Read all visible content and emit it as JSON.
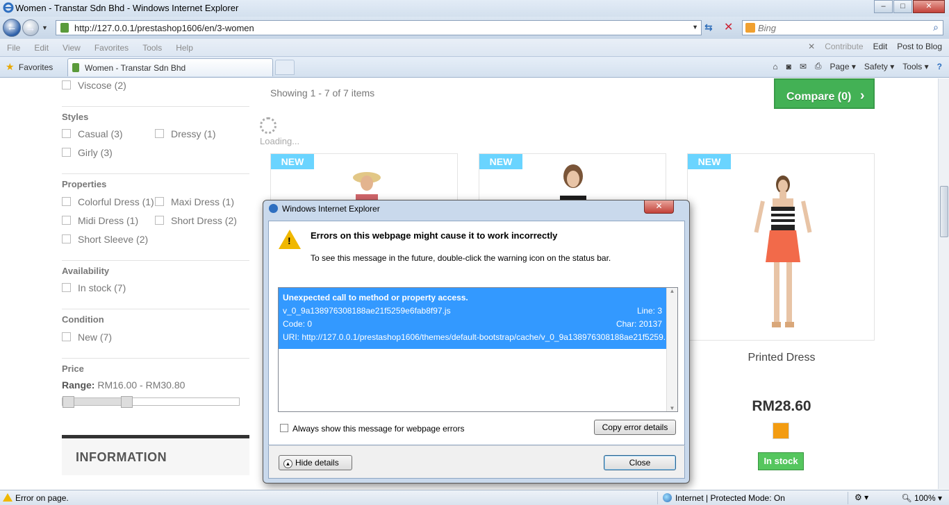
{
  "window": {
    "title": "Women - Transtar Sdn Bhd - Windows Internet Explorer",
    "controls": {
      "minimize": "–",
      "maximize": "□",
      "close": "✕"
    }
  },
  "address": {
    "back_glyph": "←",
    "forward_glyph": "→",
    "url": "http://127.0.0.1/prestashop1606/en/3-women",
    "search_placeholder": "Bing"
  },
  "menu": {
    "items": [
      "File",
      "Edit",
      "View",
      "Favorites",
      "Tools",
      "Help"
    ],
    "contribute": "Contribute",
    "edit": "Edit",
    "post_to_blog": "Post to Blog"
  },
  "favorites_bar": {
    "favorites_label": "Favorites",
    "tab_label": "Women - Transtar Sdn Bhd",
    "commands": [
      "Page ▾",
      "Safety ▾",
      "Tools ▾"
    ]
  },
  "sidebar": {
    "filters": {
      "viscose": "Viscose (2)",
      "styles_title": "Styles",
      "casual": "Casual (3)",
      "dressy": "Dressy (1)",
      "girly": "Girly (3)",
      "properties_title": "Properties",
      "colorful_dress": "Colorful Dress (1)",
      "maxi_dress": "Maxi Dress (1)",
      "midi_dress": "Midi Dress (1)",
      "short_dress": "Short Dress (2)",
      "short_sleeve": "Short Sleeve (2)",
      "availability_title": "Availability",
      "in_stock": "In stock (7)",
      "condition_title": "Condition",
      "new": "New (7)",
      "price_title": "Price",
      "range_label": "Range:",
      "range_value": " RM16.00 - RM30.80"
    },
    "price_slider": {
      "min_fraction": 0.0,
      "max_fraction": 0.35
    },
    "information_title": "INFORMATION"
  },
  "listing": {
    "showing": "Showing 1 - 7 of 7 items",
    "compare_label": "Compare (0)",
    "compare_arrow": "›",
    "loading": "Loading...",
    "new_badge": "NEW",
    "product_name": "Printed Dress",
    "product_price": "RM28.60",
    "availability": "In stock"
  },
  "dialog": {
    "title": "Windows Internet Explorer",
    "close_glyph": "✕",
    "warning_glyph": "!",
    "heading": "Errors on this webpage might cause it to work incorrectly",
    "subtext": "To see this message in the future, double-click the warning icon on the status bar.",
    "error": {
      "message": "Unexpected call to method or property access.",
      "file": "v_0_9a138976308188ae21f5259e6fab8f97.js",
      "line": "Line: 3",
      "code": "Code: 0",
      "char": "Char: 20137",
      "uri": "URI: http://127.0.0.1/prestashop1606/themes/default-bootstrap/cache/v_0_9a138976308188ae21f5259..."
    },
    "always_show_label": "Always show this message for webpage errors",
    "copy_button": "Copy error details",
    "hide_button": "Hide details",
    "close_button": "Close"
  },
  "statusbar": {
    "error_text": "Error on page.",
    "zone_text": "Internet | Protected Mode: On",
    "zoom": "100%"
  },
  "colors": {
    "new_badge": "#6ad4ff",
    "compare_green": "#43b155",
    "instock_green": "#55c65e",
    "swatch_orange": "#f39c11",
    "selection_blue": "#3399ff"
  }
}
